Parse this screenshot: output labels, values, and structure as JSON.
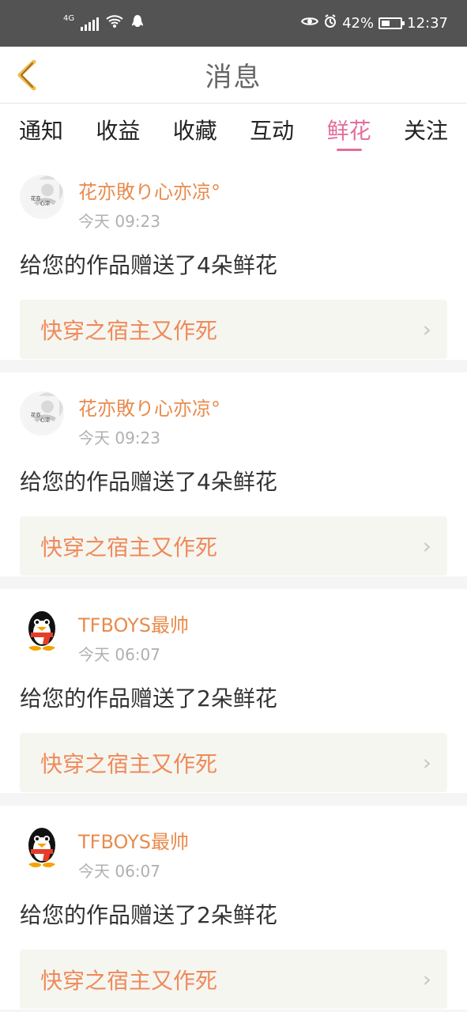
{
  "status": {
    "network": "4G",
    "battery": "42%",
    "time": "12:37"
  },
  "header": {
    "title": "消息"
  },
  "tabs": [
    {
      "label": "通知"
    },
    {
      "label": "收益"
    },
    {
      "label": "收藏"
    },
    {
      "label": "互动"
    },
    {
      "label": "鲜花"
    },
    {
      "label": "关注"
    }
  ],
  "feed": [
    {
      "avatar_icon": "flower-avatar",
      "username": "花亦敗り心亦凉°",
      "time": "今天 09:23",
      "message": "给您的作品赠送了4朵鲜花",
      "work_title": "快穿之宿主又作死"
    },
    {
      "avatar_icon": "flower-avatar",
      "username": "花亦敗り心亦凉°",
      "time": "今天 09:23",
      "message": "给您的作品赠送了4朵鲜花",
      "work_title": "快穿之宿主又作死"
    },
    {
      "avatar_icon": "penguin-avatar",
      "username": "TFBOYS最帅",
      "time": "今天 06:07",
      "message": "给您的作品赠送了2朵鲜花",
      "work_title": "快穿之宿主又作死"
    },
    {
      "avatar_icon": "penguin-avatar",
      "username": "TFBOYS最帅",
      "time": "今天 06:07",
      "message": "给您的作品赠送了2朵鲜花",
      "work_title": "快穿之宿主又作死"
    }
  ]
}
